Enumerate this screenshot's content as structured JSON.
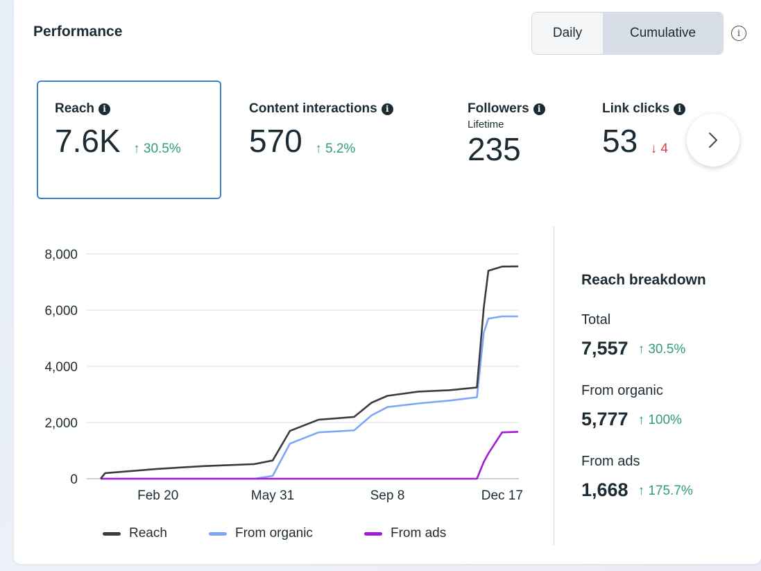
{
  "header": {
    "title": "Performance",
    "toggle": {
      "daily": "Daily",
      "cumulative": "Cumulative",
      "selected": "Cumulative"
    },
    "info_icon": "info-circle-icon"
  },
  "metrics": [
    {
      "label": "Reach",
      "value": "7.6K",
      "delta": "30.5%",
      "direction": "up"
    },
    {
      "label": "Content interactions",
      "value": "570",
      "delta": "5.2%",
      "direction": "up"
    },
    {
      "label": "Followers",
      "sublabel": "Lifetime",
      "value": "235"
    },
    {
      "label": "Link clicks",
      "value": "53",
      "delta": "4",
      "direction": "down"
    }
  ],
  "breakdown": {
    "title": "Reach breakdown",
    "rows": [
      {
        "label": "Total",
        "value": "7,557",
        "delta": "30.5%"
      },
      {
        "label": "From organic",
        "value": "5,777",
        "delta": "100%"
      },
      {
        "label": "From ads",
        "value": "1,668",
        "delta": "175.7%"
      }
    ]
  },
  "colors": {
    "reach": "#3b3b3b",
    "organic": "#7ea6f5",
    "ads": "#a21ad6",
    "up": "#2f9e6e",
    "down": "#d23f3f",
    "selected_border": "#3b82c4"
  },
  "chart_data": {
    "type": "line",
    "y_ticks": [
      "0",
      "2,000",
      "4,000",
      "6,000",
      "8,000"
    ],
    "x_ticks": [
      "Feb 20",
      "May 31",
      "Sep 8",
      "Dec 17"
    ],
    "ylim": [
      0,
      8000
    ],
    "grid": true,
    "legend_position": "bottom",
    "x": [
      "Jan 1",
      "Jan 5",
      "Feb 20",
      "Apr 1",
      "May 15",
      "May 31",
      "Jun 15",
      "Jul 10",
      "Aug 10",
      "Aug 25",
      "Sep 8",
      "Oct 5",
      "Nov 1",
      "Nov 25",
      "Dec 1",
      "Dec 5",
      "Dec 17",
      "Dec 31"
    ],
    "series": [
      {
        "name": "Reach",
        "values": [
          0,
          200,
          350,
          450,
          520,
          650,
          1700,
          2100,
          2200,
          2700,
          2950,
          3100,
          3150,
          3250,
          6100,
          7400,
          7550,
          7557
        ]
      },
      {
        "name": "From organic",
        "values": [
          0,
          0,
          0,
          0,
          0,
          100,
          1250,
          1650,
          1720,
          2250,
          2550,
          2680,
          2780,
          2900,
          5200,
          5700,
          5777,
          5777
        ]
      },
      {
        "name": "From ads",
        "values": [
          0,
          0,
          0,
          0,
          0,
          0,
          0,
          0,
          0,
          0,
          0,
          0,
          0,
          0,
          600,
          900,
          1650,
          1668
        ]
      }
    ]
  }
}
